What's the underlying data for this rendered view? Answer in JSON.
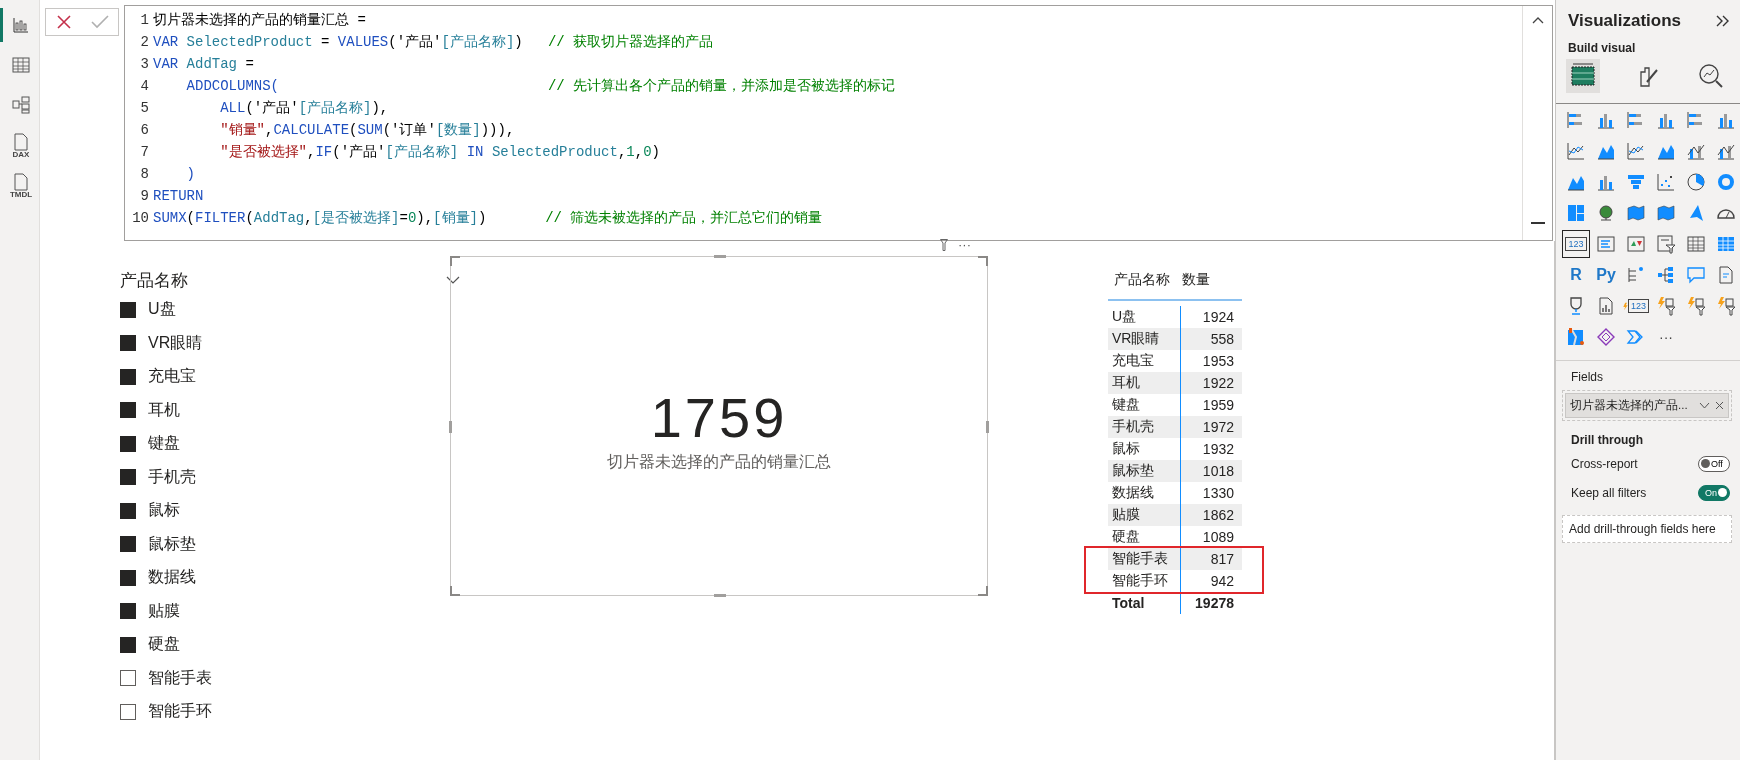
{
  "nav": [
    {
      "selected": true
    },
    {
      "selected": false
    },
    {
      "selected": false
    },
    {
      "selected": false,
      "label": "DAX"
    },
    {
      "selected": false,
      "label": "TMDL"
    }
  ],
  "formula": {
    "lines": [
      {
        "num": "1",
        "tokens": [
          {
            "t": "切片器未选择的产品的销量汇总 =",
            "kind": "plain"
          }
        ]
      },
      {
        "num": "2",
        "tokens": [
          {
            "t": "VAR ",
            "kind": "kw"
          },
          {
            "t": "SelectedProduct",
            "kind": "var"
          },
          {
            "t": " = ",
            "kind": "plain"
          },
          {
            "t": "VALUES",
            "kind": "kw"
          },
          {
            "t": "('产品'",
            "kind": "plain"
          },
          {
            "t": "[产品名称]",
            "kind": "var"
          },
          {
            "t": ")",
            "kind": "plain"
          },
          {
            "t": "   // 获取切片器选择的产品",
            "kind": "comment"
          }
        ]
      },
      {
        "num": "3",
        "tokens": [
          {
            "t": "VAR ",
            "kind": "kw"
          },
          {
            "t": "AddTag",
            "kind": "var"
          },
          {
            "t": " =",
            "kind": "plain"
          }
        ]
      },
      {
        "num": "4",
        "tokens": [
          {
            "t": "    ADDCOLUMNS(",
            "kind": "kw"
          },
          {
            "t": "                                // 先计算出各个产品的销量，并添加是否被选择的标记",
            "kind": "comment"
          }
        ]
      },
      {
        "num": "5",
        "tokens": [
          {
            "t": "        ALL",
            "kind": "kw"
          },
          {
            "t": "('产品'",
            "kind": "plain"
          },
          {
            "t": "[产品名称]",
            "kind": "var"
          },
          {
            "t": "),",
            "kind": "plain"
          }
        ]
      },
      {
        "num": "6",
        "tokens": [
          {
            "t": "        \"销量\"",
            "kind": "string"
          },
          {
            "t": ",",
            "kind": "plain"
          },
          {
            "t": "CALCULATE",
            "kind": "kw"
          },
          {
            "t": "(",
            "kind": "plain"
          },
          {
            "t": "SUM",
            "kind": "kw"
          },
          {
            "t": "('订单'",
            "kind": "plain"
          },
          {
            "t": "[数量]",
            "kind": "var"
          },
          {
            "t": "))),",
            "kind": "plain"
          }
        ]
      },
      {
        "num": "7",
        "tokens": [
          {
            "t": "        \"是否被选择\"",
            "kind": "string"
          },
          {
            "t": ",",
            "kind": "plain"
          },
          {
            "t": "IF",
            "kind": "kw"
          },
          {
            "t": "('产品'",
            "kind": "plain"
          },
          {
            "t": "[产品名称]",
            "kind": "var"
          },
          {
            "t": " IN ",
            "kind": "kw"
          },
          {
            "t": "SelectedProduct",
            "kind": "var"
          },
          {
            "t": ",",
            "kind": "plain"
          },
          {
            "t": "1",
            "kind": "number"
          },
          {
            "t": ",",
            "kind": "plain"
          },
          {
            "t": "0",
            "kind": "number"
          },
          {
            "t": ")",
            "kind": "plain"
          }
        ]
      },
      {
        "num": "8",
        "tokens": [
          {
            "t": "    )",
            "kind": "kw"
          }
        ]
      },
      {
        "num": "9",
        "tokens": [
          {
            "t": "RETURN",
            "kind": "kw"
          }
        ]
      },
      {
        "num": "10",
        "tokens": [
          {
            "t": "SUMX",
            "kind": "kw"
          },
          {
            "t": "(",
            "kind": "plain"
          },
          {
            "t": "FILTER",
            "kind": "kw"
          },
          {
            "t": "(",
            "kind": "plain"
          },
          {
            "t": "AddTag",
            "kind": "var"
          },
          {
            "t": ",",
            "kind": "plain"
          },
          {
            "t": "[是否被选择]",
            "kind": "var"
          },
          {
            "t": "=",
            "kind": "plain"
          },
          {
            "t": "0",
            "kind": "number"
          },
          {
            "t": "),",
            "kind": "plain"
          },
          {
            "t": "[销量]",
            "kind": "var"
          },
          {
            "t": ")",
            "kind": "plain"
          },
          {
            "t": "       // 筛选未被选择的产品，并汇总它们的销量",
            "kind": "comment"
          }
        ]
      }
    ]
  },
  "slicer": {
    "title": "产品名称",
    "items": [
      {
        "label": "U盘",
        "checked": true
      },
      {
        "label": "VR眼睛",
        "checked": true
      },
      {
        "label": "充电宝",
        "checked": true
      },
      {
        "label": "耳机",
        "checked": true
      },
      {
        "label": "键盘",
        "checked": true
      },
      {
        "label": "手机壳",
        "checked": true
      },
      {
        "label": "鼠标",
        "checked": true
      },
      {
        "label": "鼠标垫",
        "checked": true
      },
      {
        "label": "数据线",
        "checked": true
      },
      {
        "label": "贴膜",
        "checked": true
      },
      {
        "label": "硬盘",
        "checked": true
      },
      {
        "label": "智能手表",
        "checked": false
      },
      {
        "label": "智能手环",
        "checked": false
      }
    ]
  },
  "card": {
    "more": "···",
    "value": "1759",
    "label": "切片器未选择的产品的销量汇总"
  },
  "table": {
    "columns": [
      "产品名称",
      "数量"
    ],
    "rows": [
      {
        "name": "U盘",
        "qty": "1924",
        "highlighted": false
      },
      {
        "name": "VR眼睛",
        "qty": "558",
        "highlighted": false
      },
      {
        "name": "充电宝",
        "qty": "1953",
        "highlighted": false
      },
      {
        "name": "耳机",
        "qty": "1922",
        "highlighted": false
      },
      {
        "name": "键盘",
        "qty": "1959",
        "highlighted": false
      },
      {
        "name": "手机壳",
        "qty": "1972",
        "highlighted": false
      },
      {
        "name": "鼠标",
        "qty": "1932",
        "highlighted": false
      },
      {
        "name": "鼠标垫",
        "qty": "1018",
        "highlighted": false
      },
      {
        "name": "数据线",
        "qty": "1330",
        "highlighted": false
      },
      {
        "name": "贴膜",
        "qty": "1862",
        "highlighted": false
      },
      {
        "name": "硬盘",
        "qty": "1089",
        "highlighted": false
      },
      {
        "name": "智能手表",
        "qty": "817",
        "highlighted": true
      },
      {
        "name": "智能手环",
        "qty": "942",
        "highlighted": true
      }
    ],
    "total": {
      "label": "Total",
      "value": "19278"
    }
  },
  "pane": {
    "title": "Visualizations",
    "build_label": "Build visual",
    "build_tabs": [
      {
        "selected": true
      },
      {
        "selected": false
      },
      {
        "selected": false
      }
    ],
    "gallery": [
      {
        "selected": false
      },
      {
        "selected": false
      },
      {
        "selected": false
      },
      {
        "selected": false
      },
      {
        "selected": false
      },
      {
        "selected": false
      },
      {
        "selected": false
      },
      {
        "selected": false
      },
      {
        "selected": false
      },
      {
        "selected": false
      },
      {
        "selected": false
      },
      {
        "selected": false
      },
      {
        "selected": false
      },
      {
        "selected": false
      },
      {
        "selected": false
      },
      {
        "selected": false
      },
      {
        "selected": false
      },
      {
        "selected": false
      },
      {
        "selected": false
      },
      {
        "selected": false
      },
      {
        "selected": false
      },
      {
        "selected": false
      },
      {
        "selected": false
      },
      {
        "selected": false
      },
      {
        "selected": true,
        "label": "123"
      },
      {
        "selected": false
      },
      {
        "selected": false
      },
      {
        "selected": false
      },
      {
        "selected": false
      },
      {
        "selected": false
      },
      {
        "selected": false,
        "label": "R"
      },
      {
        "selected": false,
        "label": "Py"
      },
      {
        "selected": false
      },
      {
        "selected": false
      },
      {
        "selected": false
      },
      {
        "selected": false
      },
      {
        "selected": false
      },
      {
        "selected": false
      },
      {
        "selected": false,
        "label": "123"
      },
      {
        "selected": false
      },
      {
        "selected": false
      },
      {
        "selected": false
      },
      {
        "selected": false
      },
      {
        "selected": false
      },
      {
        "selected": false
      },
      {
        "selected": false,
        "label": "···"
      }
    ],
    "fields_label": "Fields",
    "field": "切片器未选择的产品...",
    "drill_label": "Drill through",
    "toggles": [
      {
        "label": "Cross-report",
        "on": false,
        "text": "Off"
      },
      {
        "label": "Keep all filters",
        "on": true,
        "text": "On"
      }
    ],
    "drop_hint": "Add drill-through fields here"
  }
}
